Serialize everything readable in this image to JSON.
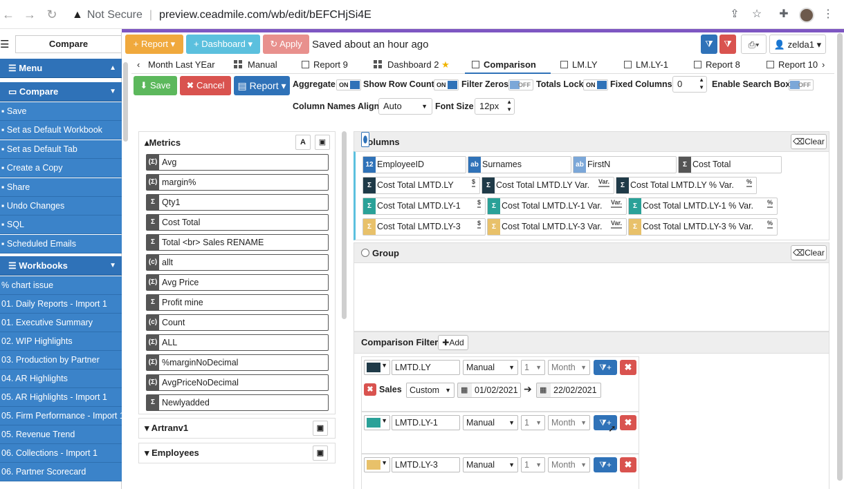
{
  "browser": {
    "not_secure": "Not Secure",
    "url": "preview.ceadmile.com/wb/edit/bEFCHjSi4E"
  },
  "sidebar": {
    "compare_label": "Compare",
    "menu_header": "Menu",
    "compare_header": "Compare",
    "compare_items": [
      "Save",
      "Set as Default Workbook",
      "Set as Default Tab",
      "Create a Copy",
      "Share",
      "Undo Changes",
      "SQL",
      "Scheduled Emails"
    ],
    "workbooks_header": "Workbooks",
    "workbooks": [
      "% chart issue",
      "01. Daily Reports - Import 1",
      "01. Executive Summary",
      "02. WIP Highlights",
      "03. Production by Partner",
      "04. AR Highlights",
      "05. AR Highlights - Import 1",
      "05. Firm Performance - Import 1",
      "05. Revenue Trend",
      "06. Collections - Import 1",
      "06. Partner Scorecard"
    ]
  },
  "toolbar": {
    "report": "Report",
    "dashboard": "Dashboard",
    "apply": "Apply",
    "saved_status": "Saved about an hour ago",
    "user": "zelda1"
  },
  "tabs": [
    "Month Last YEar",
    "Manual",
    "Report 9",
    "Dashboard 2",
    "Comparison",
    "LM.LY",
    "LM.LY-1",
    "Report 8",
    "Report 10"
  ],
  "active_tab": "Comparison",
  "actions": {
    "save": "Save",
    "cancel": "Cancel",
    "report": "Report"
  },
  "options": {
    "aggregate": "Aggregate",
    "show_row_count": "Show Row Count",
    "filter_zeros": "Filter Zeros",
    "totals_lock": "Totals Lock",
    "fixed_columns": "Fixed Columns",
    "fixed_columns_value": "0",
    "enable_search_box": "Enable Search Box",
    "on": "ON",
    "off": "OFF",
    "column_names_align": "Column Names Align",
    "column_names_align_value": "Auto",
    "font_size": "Font Size",
    "font_size_value": "12px"
  },
  "metrics": {
    "header": "Metrics",
    "items": [
      {
        "icon": "(Σ)",
        "label": "Avg"
      },
      {
        "icon": "(Σ)",
        "label": "margin%"
      },
      {
        "icon": "Σ",
        "label": "Qty1"
      },
      {
        "icon": "Σ",
        "label": "Cost Total"
      },
      {
        "icon": "Σ",
        "label": "Total <br> Sales RENAME"
      },
      {
        "icon": "(c)",
        "label": "allt"
      },
      {
        "icon": "(Σ)",
        "label": "Avg Price"
      },
      {
        "icon": "Σ",
        "label": "Profit mine"
      },
      {
        "icon": "(c)",
        "label": "Count"
      },
      {
        "icon": "(Σ)",
        "label": "ALL"
      },
      {
        "icon": "(Σ)",
        "label": "%marginNoDecimal"
      },
      {
        "icon": "(Σ)",
        "label": "AvgPriceNoDecimal"
      },
      {
        "icon": "Σ",
        "label": "Newlyadded"
      }
    ],
    "sections": [
      "Artranv1",
      "Employees"
    ]
  },
  "columns": {
    "header": "Columns",
    "clear": "Clear",
    "rows": [
      [
        {
          "icon": "12",
          "label": "EmployeeID",
          "color": "#2f72b8"
        },
        {
          "icon": "ab",
          "label": "Surnames",
          "color": "#2f72b8"
        },
        {
          "icon": "ab",
          "label": "FirstN",
          "color": "#7ba7d8"
        },
        {
          "icon": "Σ",
          "label": "Cost Total",
          "color": "#555555"
        }
      ],
      [
        {
          "icon": "Σ",
          "label": "Cost Total LMTD.LY",
          "color": "#1f3a48",
          "suffix": "$"
        },
        {
          "icon": "Σ",
          "label": "Cost Total LMTD.LY Var.",
          "color": "#1f3a48",
          "suffix": "Var."
        },
        {
          "icon": "Σ",
          "label": "Cost Total LMTD.LY % Var.",
          "color": "#1f3a48",
          "suffix": "%"
        }
      ],
      [
        {
          "icon": "Σ",
          "label": "Cost Total LMTD.LY-1",
          "color": "#2aa198",
          "suffix": "$"
        },
        {
          "icon": "Σ",
          "label": "Cost Total LMTD.LY-1 Var.",
          "color": "#2aa198",
          "suffix": "Var."
        },
        {
          "icon": "Σ",
          "label": "Cost Total LMTD.LY-1 % Var.",
          "color": "#2aa198",
          "suffix": "%"
        }
      ],
      [
        {
          "icon": "Σ",
          "label": "Cost Total LMTD.LY-3",
          "color": "#e8c16a",
          "suffix": "$"
        },
        {
          "icon": "Σ",
          "label": "Cost Total LMTD.LY-3 Var.",
          "color": "#e8c16a",
          "suffix": "Var."
        },
        {
          "icon": "Σ",
          "label": "Cost Total LMTD.LY-3 % Var.",
          "color": "#e8c16a",
          "suffix": "%"
        }
      ]
    ]
  },
  "group": {
    "header": "Group",
    "clear": "Clear"
  },
  "filters": {
    "header": "Comparison Filters",
    "add": "Add",
    "rows": [
      {
        "color": "#1f3a48",
        "name": "LMTD.LY",
        "mode": "Manual",
        "num": "1",
        "unit": "Month"
      },
      {
        "color": "#2aa198",
        "name": "LMTD.LY-1",
        "mode": "Manual",
        "num": "1",
        "unit": "Month"
      },
      {
        "color": "#e8c16a",
        "name": "LMTD.LY-3",
        "mode": "Manual",
        "num": "1",
        "unit": "Month"
      }
    ],
    "sub": {
      "label": "Sales",
      "mode": "Custom",
      "from": "01/02/2021",
      "to": "22/02/2021"
    }
  }
}
